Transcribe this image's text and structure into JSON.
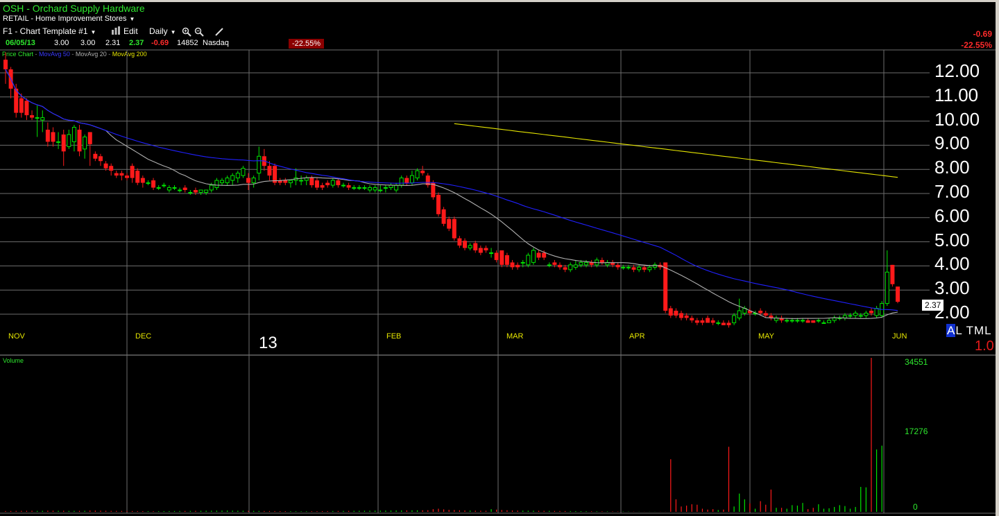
{
  "header": {
    "title": "OSH - Orchard Supply Hardware",
    "industry": "RETAIL - Home Improvement Stores",
    "template": "F1 - Chart Template #1",
    "edit": "Edit",
    "period": "Daily"
  },
  "quote": {
    "date": "06/05/13",
    "open": "3.00",
    "high": "3.00",
    "low": "2.31",
    "close": "2.37",
    "change": "-0.69",
    "volume": "14852",
    "exchange": "Nasdaq",
    "pct": "-22.55%",
    "right_change": "-0.69",
    "right_pct": "-22.55%"
  },
  "legend": {
    "price": "Price Chart",
    "ma50": "MovAvg 50",
    "ma20": "MovAvg 20",
    "ma200": "MovAvg 200"
  },
  "price_labels": [
    "12.00",
    "11.00",
    "10.00",
    "9.00",
    "8.00",
    "7.00",
    "6.00",
    "5.00",
    "4.00",
    "3.00",
    "2.00"
  ],
  "months": [
    "NOV",
    "DEC",
    "13",
    "FEB",
    "MAR",
    "APR",
    "MAY",
    "JUN"
  ],
  "last_price_tag": "2.37",
  "atml": "ATML",
  "atml_a": "A",
  "atml_rest": "L TML",
  "one_label": "1.0",
  "volume": {
    "label": "Volume",
    "ticks": [
      "34551",
      "17276",
      "0"
    ]
  },
  "colors": {
    "up": "#00e600",
    "down": "#ff1a1a",
    "ma50": "#2020ff",
    "ma20": "#b0b0b0",
    "ma200": "#e6e600",
    "grid": "#6e6e6e"
  },
  "chart_data": {
    "type": "candlestick",
    "x_label_months": [
      "NOV",
      "DEC",
      "JAN (13)",
      "FEB",
      "MAR",
      "APR",
      "MAY",
      "JUN"
    ],
    "ylim": [
      1.0,
      12.5
    ],
    "candles": [
      {
        "o": 12.4,
        "h": 12.7,
        "l": 11.4,
        "c": 12.0
      },
      {
        "o": 12.0,
        "h": 12.1,
        "l": 10.8,
        "c": 11.2
      },
      {
        "o": 11.2,
        "h": 11.4,
        "l": 10.0,
        "c": 10.2
      },
      {
        "o": 10.8,
        "h": 11.0,
        "l": 10.0,
        "c": 10.2
      },
      {
        "o": 10.7,
        "h": 10.8,
        "l": 9.9,
        "c": 10.1
      },
      {
        "o": 10.1,
        "h": 10.3,
        "l": 9.9,
        "c": 10.0
      },
      {
        "o": 10.0,
        "h": 10.5,
        "l": 9.2,
        "c": 10.0
      },
      {
        "o": 9.9,
        "h": 10.3,
        "l": 9.4,
        "c": 10.0
      },
      {
        "o": 9.5,
        "h": 9.8,
        "l": 8.8,
        "c": 9.0
      },
      {
        "o": 9.4,
        "h": 9.6,
        "l": 8.8,
        "c": 9.0
      },
      {
        "o": 9.0,
        "h": 9.4,
        "l": 8.7,
        "c": 9.0
      },
      {
        "o": 9.3,
        "h": 9.5,
        "l": 8.0,
        "c": 8.6
      },
      {
        "o": 8.8,
        "h": 9.5,
        "l": 8.7,
        "c": 9.3
      },
      {
        "o": 9.0,
        "h": 9.7,
        "l": 8.6,
        "c": 9.6
      },
      {
        "o": 9.5,
        "h": 9.7,
        "l": 8.4,
        "c": 8.6
      },
      {
        "o": 8.7,
        "h": 9.3,
        "l": 8.3,
        "c": 9.2
      },
      {
        "o": 9.4,
        "h": 9.4,
        "l": 8.0,
        "c": 8.9
      },
      {
        "o": 8.5,
        "h": 8.6,
        "l": 8.2,
        "c": 8.3
      },
      {
        "o": 8.4,
        "h": 8.5,
        "l": 8.0,
        "c": 8.2
      },
      {
        "o": 8.1,
        "h": 8.2,
        "l": 7.8,
        "c": 7.9
      },
      {
        "o": 8.0,
        "h": 8.1,
        "l": 7.6,
        "c": 7.8
      },
      {
        "o": 7.7,
        "h": 7.8,
        "l": 7.5,
        "c": 7.6
      },
      {
        "o": 7.7,
        "h": 7.8,
        "l": 7.4,
        "c": 7.6
      },
      {
        "o": 7.6,
        "h": 7.7,
        "l": 7.4,
        "c": 7.5
      },
      {
        "o": 8.0,
        "h": 8.1,
        "l": 7.3,
        "c": 7.5
      },
      {
        "o": 7.8,
        "h": 7.9,
        "l": 7.2,
        "c": 7.3
      },
      {
        "o": 7.5,
        "h": 7.6,
        "l": 7.1,
        "c": 7.3
      },
      {
        "o": 7.3,
        "h": 7.4,
        "l": 7.2,
        "c": 7.3
      },
      {
        "o": 7.4,
        "h": 7.5,
        "l": 7.0,
        "c": 7.1
      },
      {
        "o": 7.1,
        "h": 7.2,
        "l": 7.0,
        "c": 7.1
      },
      {
        "o": 7.2,
        "h": 7.3,
        "l": 7.1,
        "c": 7.2
      },
      {
        "o": 7.0,
        "h": 7.2,
        "l": 6.9,
        "c": 7.1
      },
      {
        "o": 7.1,
        "h": 7.2,
        "l": 7.0,
        "c": 7.1
      },
      {
        "o": 7.0,
        "h": 7.1,
        "l": 6.9,
        "c": 7.0
      },
      {
        "o": 7.1,
        "h": 7.2,
        "l": 6.9,
        "c": 7.0
      },
      {
        "o": 6.9,
        "h": 7.0,
        "l": 6.8,
        "c": 6.9
      },
      {
        "o": 7.0,
        "h": 7.1,
        "l": 6.8,
        "c": 6.9
      },
      {
        "o": 6.9,
        "h": 7.0,
        "l": 6.8,
        "c": 7.0
      },
      {
        "o": 6.9,
        "h": 7.0,
        "l": 6.8,
        "c": 7.0
      },
      {
        "o": 7.0,
        "h": 7.3,
        "l": 6.9,
        "c": 7.2
      },
      {
        "o": 7.1,
        "h": 7.5,
        "l": 7.0,
        "c": 7.4
      },
      {
        "o": 7.3,
        "h": 7.5,
        "l": 7.2,
        "c": 7.4
      },
      {
        "o": 7.3,
        "h": 7.6,
        "l": 7.2,
        "c": 7.5
      },
      {
        "o": 7.4,
        "h": 7.7,
        "l": 7.2,
        "c": 7.6
      },
      {
        "o": 7.5,
        "h": 7.8,
        "l": 7.3,
        "c": 7.7
      },
      {
        "o": 7.6,
        "h": 8.0,
        "l": 7.5,
        "c": 7.9
      },
      {
        "o": 7.5,
        "h": 7.7,
        "l": 7.0,
        "c": 7.3
      },
      {
        "o": 7.3,
        "h": 7.6,
        "l": 7.1,
        "c": 7.5
      },
      {
        "o": 7.7,
        "h": 8.8,
        "l": 7.4,
        "c": 8.4
      },
      {
        "o": 8.4,
        "h": 8.7,
        "l": 7.8,
        "c": 8.0
      },
      {
        "o": 8.0,
        "h": 8.2,
        "l": 7.4,
        "c": 7.6
      },
      {
        "o": 8.0,
        "h": 8.1,
        "l": 7.2,
        "c": 7.3
      },
      {
        "o": 7.4,
        "h": 7.5,
        "l": 7.2,
        "c": 7.3
      },
      {
        "o": 7.4,
        "h": 7.5,
        "l": 7.2,
        "c": 7.3
      },
      {
        "o": 7.3,
        "h": 7.4,
        "l": 7.1,
        "c": 7.4
      },
      {
        "o": 7.4,
        "h": 7.9,
        "l": 7.2,
        "c": 7.5
      },
      {
        "o": 7.4,
        "h": 7.6,
        "l": 7.2,
        "c": 7.4
      },
      {
        "o": 7.4,
        "h": 7.6,
        "l": 7.2,
        "c": 7.5
      },
      {
        "o": 7.5,
        "h": 7.6,
        "l": 7.1,
        "c": 7.2
      },
      {
        "o": 7.4,
        "h": 7.5,
        "l": 7.0,
        "c": 7.1
      },
      {
        "o": 7.2,
        "h": 7.3,
        "l": 7.0,
        "c": 7.1
      },
      {
        "o": 7.3,
        "h": 7.4,
        "l": 7.1,
        "c": 7.2
      },
      {
        "o": 7.2,
        "h": 7.5,
        "l": 7.1,
        "c": 7.4
      },
      {
        "o": 7.4,
        "h": 7.5,
        "l": 7.1,
        "c": 7.2
      },
      {
        "o": 7.2,
        "h": 7.3,
        "l": 7.1,
        "c": 7.2
      },
      {
        "o": 7.2,
        "h": 7.3,
        "l": 7.0,
        "c": 7.1
      },
      {
        "o": 7.1,
        "h": 7.2,
        "l": 7.0,
        "c": 7.1
      },
      {
        "o": 7.1,
        "h": 7.2,
        "l": 7.0,
        "c": 7.1
      },
      {
        "o": 7.1,
        "h": 7.2,
        "l": 7.0,
        "c": 7.1
      },
      {
        "o": 7.0,
        "h": 7.2,
        "l": 6.9,
        "c": 7.1
      },
      {
        "o": 7.0,
        "h": 7.2,
        "l": 6.9,
        "c": 7.1
      },
      {
        "o": 7.0,
        "h": 7.2,
        "l": 6.9,
        "c": 7.0
      },
      {
        "o": 7.1,
        "h": 7.2,
        "l": 6.9,
        "c": 7.1
      },
      {
        "o": 7.1,
        "h": 7.3,
        "l": 7.0,
        "c": 7.2
      },
      {
        "o": 7.0,
        "h": 7.3,
        "l": 6.9,
        "c": 7.2
      },
      {
        "o": 7.2,
        "h": 7.6,
        "l": 7.1,
        "c": 7.5
      },
      {
        "o": 7.5,
        "h": 7.6,
        "l": 7.2,
        "c": 7.3
      },
      {
        "o": 7.3,
        "h": 7.8,
        "l": 7.2,
        "c": 7.6
      },
      {
        "o": 7.5,
        "h": 7.9,
        "l": 7.4,
        "c": 7.8
      },
      {
        "o": 7.8,
        "h": 8.0,
        "l": 7.6,
        "c": 7.7
      },
      {
        "o": 7.6,
        "h": 7.7,
        "l": 7.1,
        "c": 7.2
      },
      {
        "o": 7.3,
        "h": 7.4,
        "l": 6.6,
        "c": 6.7
      },
      {
        "o": 6.8,
        "h": 6.9,
        "l": 5.9,
        "c": 6.0
      },
      {
        "o": 6.2,
        "h": 6.3,
        "l": 5.5,
        "c": 5.6
      },
      {
        "o": 5.8,
        "h": 5.9,
        "l": 5.3,
        "c": 5.4
      },
      {
        "o": 5.8,
        "h": 5.9,
        "l": 4.9,
        "c": 5.0
      },
      {
        "o": 5.0,
        "h": 5.1,
        "l": 4.6,
        "c": 4.7
      },
      {
        "o": 4.9,
        "h": 5.0,
        "l": 4.5,
        "c": 4.6
      },
      {
        "o": 4.6,
        "h": 4.8,
        "l": 4.5,
        "c": 4.7
      },
      {
        "o": 4.8,
        "h": 4.9,
        "l": 4.4,
        "c": 4.5
      },
      {
        "o": 4.6,
        "h": 4.7,
        "l": 4.3,
        "c": 4.4
      },
      {
        "o": 4.6,
        "h": 4.7,
        "l": 4.4,
        "c": 4.5
      },
      {
        "o": 4.4,
        "h": 4.6,
        "l": 4.2,
        "c": 4.4
      },
      {
        "o": 4.4,
        "h": 4.5,
        "l": 4.0,
        "c": 4.1
      },
      {
        "o": 4.5,
        "h": 4.5,
        "l": 3.8,
        "c": 3.9
      },
      {
        "o": 4.3,
        "h": 4.4,
        "l": 3.8,
        "c": 3.9
      },
      {
        "o": 4.0,
        "h": 4.1,
        "l": 3.7,
        "c": 3.8
      },
      {
        "o": 3.9,
        "h": 4.0,
        "l": 3.7,
        "c": 3.8
      },
      {
        "o": 4.0,
        "h": 4.1,
        "l": 3.8,
        "c": 4.0
      },
      {
        "o": 3.9,
        "h": 4.4,
        "l": 3.8,
        "c": 4.3
      },
      {
        "o": 4.0,
        "h": 4.6,
        "l": 3.9,
        "c": 4.5
      },
      {
        "o": 4.4,
        "h": 4.5,
        "l": 4.1,
        "c": 4.2
      },
      {
        "o": 4.4,
        "h": 4.5,
        "l": 4.1,
        "c": 4.2
      },
      {
        "o": 3.9,
        "h": 4.0,
        "l": 3.8,
        "c": 3.9
      },
      {
        "o": 4.0,
        "h": 4.1,
        "l": 3.8,
        "c": 3.9
      },
      {
        "o": 3.9,
        "h": 4.0,
        "l": 3.7,
        "c": 3.8
      },
      {
        "o": 3.8,
        "h": 3.9,
        "l": 3.6,
        "c": 3.7
      },
      {
        "o": 3.7,
        "h": 4.0,
        "l": 3.6,
        "c": 3.9
      },
      {
        "o": 3.8,
        "h": 4.1,
        "l": 3.7,
        "c": 3.9
      },
      {
        "o": 3.9,
        "h": 4.1,
        "l": 3.8,
        "c": 4.0
      },
      {
        "o": 3.9,
        "h": 4.1,
        "l": 3.8,
        "c": 4.0
      },
      {
        "o": 4.0,
        "h": 4.1,
        "l": 3.8,
        "c": 3.9
      },
      {
        "o": 3.9,
        "h": 4.2,
        "l": 3.8,
        "c": 4.1
      },
      {
        "o": 4.1,
        "h": 4.2,
        "l": 3.9,
        "c": 4.0
      },
      {
        "o": 3.9,
        "h": 4.1,
        "l": 3.8,
        "c": 4.0
      },
      {
        "o": 4.0,
        "h": 4.1,
        "l": 3.8,
        "c": 3.9
      },
      {
        "o": 3.9,
        "h": 4.0,
        "l": 3.7,
        "c": 3.8
      },
      {
        "o": 3.8,
        "h": 3.9,
        "l": 3.7,
        "c": 3.8
      },
      {
        "o": 3.8,
        "h": 3.9,
        "l": 3.7,
        "c": 3.8
      },
      {
        "o": 3.8,
        "h": 3.9,
        "l": 3.6,
        "c": 3.7
      },
      {
        "o": 3.7,
        "h": 3.9,
        "l": 3.6,
        "c": 3.8
      },
      {
        "o": 3.8,
        "h": 3.9,
        "l": 3.6,
        "c": 3.7
      },
      {
        "o": 3.7,
        "h": 3.9,
        "l": 3.6,
        "c": 3.8
      },
      {
        "o": 3.8,
        "h": 4.0,
        "l": 3.7,
        "c": 3.9
      },
      {
        "o": 3.9,
        "h": 4.0,
        "l": 3.7,
        "c": 3.8
      },
      {
        "o": 4.0,
        "h": 4.0,
        "l": 1.9,
        "c": 2.0
      },
      {
        "o": 2.1,
        "h": 2.2,
        "l": 1.7,
        "c": 1.8
      },
      {
        "o": 2.0,
        "h": 2.1,
        "l": 1.7,
        "c": 1.8
      },
      {
        "o": 1.9,
        "h": 2.0,
        "l": 1.6,
        "c": 1.7
      },
      {
        "o": 1.8,
        "h": 1.9,
        "l": 1.6,
        "c": 1.7
      },
      {
        "o": 1.7,
        "h": 1.8,
        "l": 1.5,
        "c": 1.6
      },
      {
        "o": 1.6,
        "h": 1.7,
        "l": 1.4,
        "c": 1.5
      },
      {
        "o": 1.6,
        "h": 1.7,
        "l": 1.4,
        "c": 1.5
      },
      {
        "o": 1.7,
        "h": 1.8,
        "l": 1.5,
        "c": 1.5
      },
      {
        "o": 1.6,
        "h": 1.7,
        "l": 1.4,
        "c": 1.5
      },
      {
        "o": 1.5,
        "h": 1.6,
        "l": 1.4,
        "c": 1.5
      },
      {
        "o": 1.5,
        "h": 1.6,
        "l": 1.4,
        "c": 1.4
      },
      {
        "o": 1.5,
        "h": 1.6,
        "l": 1.3,
        "c": 1.4
      },
      {
        "o": 1.5,
        "h": 1.9,
        "l": 1.4,
        "c": 1.8
      },
      {
        "o": 1.7,
        "h": 2.5,
        "l": 1.6,
        "c": 2.0
      },
      {
        "o": 1.9,
        "h": 2.2,
        "l": 1.8,
        "c": 2.1
      },
      {
        "o": 2.0,
        "h": 2.1,
        "l": 1.8,
        "c": 1.9
      },
      {
        "o": 1.9,
        "h": 2.0,
        "l": 1.8,
        "c": 1.9
      },
      {
        "o": 2.0,
        "h": 2.1,
        "l": 1.8,
        "c": 1.9
      },
      {
        "o": 1.9,
        "h": 2.0,
        "l": 1.7,
        "c": 1.8
      },
      {
        "o": 1.8,
        "h": 1.9,
        "l": 1.6,
        "c": 1.7
      },
      {
        "o": 1.6,
        "h": 1.8,
        "l": 1.5,
        "c": 1.7
      },
      {
        "o": 1.7,
        "h": 1.8,
        "l": 1.5,
        "c": 1.6
      },
      {
        "o": 1.6,
        "h": 1.7,
        "l": 1.5,
        "c": 1.6
      },
      {
        "o": 1.6,
        "h": 1.7,
        "l": 1.5,
        "c": 1.6
      },
      {
        "o": 1.6,
        "h": 1.7,
        "l": 1.5,
        "c": 1.6
      },
      {
        "o": 1.6,
        "h": 1.7,
        "l": 1.5,
        "c": 1.6
      },
      {
        "o": 1.6,
        "h": 1.7,
        "l": 1.5,
        "c": 1.5
      },
      {
        "o": 1.6,
        "h": 1.6,
        "l": 1.5,
        "c": 1.5
      },
      {
        "o": 1.6,
        "h": 1.7,
        "l": 1.5,
        "c": 1.6
      },
      {
        "o": 1.5,
        "h": 1.6,
        "l": 1.5,
        "c": 1.5
      },
      {
        "o": 1.5,
        "h": 1.7,
        "l": 1.5,
        "c": 1.6
      },
      {
        "o": 1.6,
        "h": 1.8,
        "l": 1.5,
        "c": 1.7
      },
      {
        "o": 1.7,
        "h": 1.8,
        "l": 1.6,
        "c": 1.7
      },
      {
        "o": 1.7,
        "h": 1.9,
        "l": 1.6,
        "c": 1.8
      },
      {
        "o": 1.8,
        "h": 1.9,
        "l": 1.7,
        "c": 1.8
      },
      {
        "o": 1.8,
        "h": 2.0,
        "l": 1.7,
        "c": 1.9
      },
      {
        "o": 1.8,
        "h": 1.9,
        "l": 1.7,
        "c": 1.8
      },
      {
        "o": 1.8,
        "h": 2.0,
        "l": 1.7,
        "c": 1.9
      },
      {
        "o": 2.0,
        "h": 2.1,
        "l": 1.8,
        "c": 1.9
      },
      {
        "o": 1.8,
        "h": 2.2,
        "l": 1.7,
        "c": 2.1
      },
      {
        "o": 1.8,
        "h": 2.4,
        "l": 1.7,
        "c": 2.3
      },
      {
        "o": 2.3,
        "h": 4.5,
        "l": 2.2,
        "c": 3.6
      },
      {
        "o": 3.9,
        "h": 3.9,
        "l": 3.0,
        "c": 3.1
      },
      {
        "o": 3.0,
        "h": 3.0,
        "l": 2.31,
        "c": 2.37
      }
    ],
    "volume": [
      180,
      190,
      210,
      220,
      230,
      240,
      210,
      220,
      260,
      250,
      230,
      240,
      200,
      210,
      220,
      230,
      300,
      280,
      260,
      240,
      220,
      210,
      200,
      190,
      180,
      170,
      160,
      150,
      140,
      150,
      160,
      170,
      180,
      190,
      200,
      210,
      220,
      230,
      240,
      250,
      260,
      270,
      280,
      260,
      240,
      230,
      220,
      210,
      200,
      190,
      180,
      170,
      160,
      150,
      140,
      130,
      120,
      130,
      140,
      150,
      160,
      170,
      180,
      190,
      200,
      210,
      220,
      230,
      240,
      250,
      260,
      270,
      280,
      290,
      300,
      310,
      320,
      330,
      340,
      350,
      360,
      600,
      700,
      550,
      450,
      400,
      350,
      300,
      280,
      260,
      250,
      240,
      600,
      500,
      400,
      350,
      300,
      280,
      260,
      250,
      240,
      230,
      220,
      210,
      200,
      190,
      180,
      170,
      160,
      150,
      140,
      130,
      120,
      110,
      100,
      90,
      80,
      70,
      60,
      50,
      40,
      30,
      30,
      30,
      30,
      30,
      11800,
      2800,
      1200,
      1400,
      1700,
      1600,
      700,
      500,
      600,
      400,
      500,
      14600,
      1200,
      4100,
      2800,
      1900,
      700,
      2400,
      1600,
      5000,
      900,
      900,
      700,
      1500,
      1400,
      2000,
      600,
      900,
      1700,
      700,
      800,
      1100,
      1500,
      1300,
      700,
      1100,
      5600,
      5500,
      34551,
      14000,
      14852
    ],
    "volume_ylim": [
      0,
      34551
    ],
    "moving_averages": [
      "MovAvg 50",
      "MovAvg 20",
      "MovAvg 200"
    ]
  }
}
